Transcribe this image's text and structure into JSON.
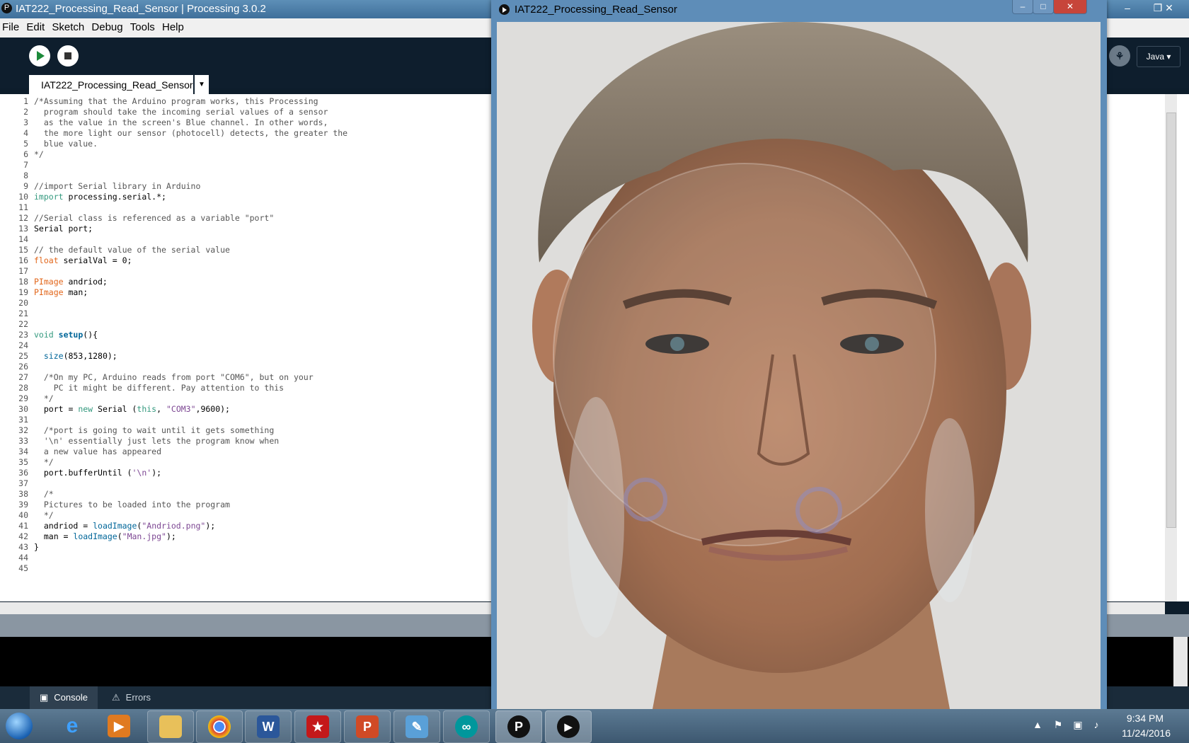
{
  "ide": {
    "title": "IAT222_Processing_Read_Sensor | Processing 3.0.2",
    "menu": [
      "File",
      "Edit",
      "Sketch",
      "Debug",
      "Tools",
      "Help"
    ],
    "mode": "Java ▾",
    "tab_name": "IAT222_Processing_Read_Sensor",
    "console_tab": "Console",
    "errors_tab": "Errors"
  },
  "code_lines": [
    "/*Assuming that the Arduino program works, this Processing",
    "  program should take the incoming serial values of a sensor",
    "  as the value in the screen's Blue channel. In other words,",
    "  the more light our sensor (photocell) detects, the greater the",
    "  blue value.",
    "*/",
    "",
    "",
    "//import Serial library in Arduino",
    "import processing.serial.*;",
    "",
    "//Serial class is referenced as a variable \"port\"",
    "Serial port;",
    "",
    "// the default value of the serial value",
    "float serialVal = 0;",
    "",
    "PImage andriod;",
    "PImage man;",
    "",
    "",
    "",
    "void setup(){",
    "",
    "  size(853,1280);",
    "",
    "  /*On my PC, Arduino reads from port \"COM6\", but on your",
    "    PC it might be different. Pay attention to this",
    "  */",
    "  port = new Serial (this, \"COM3\",9600);",
    "",
    "  /*port is going to wait until it gets something",
    "  '\\n' essentially just lets the program know when",
    "  a new value has appeared",
    "  */",
    "  port.bufferUntil ('\\n');",
    "",
    "  /*",
    "  Pictures to be loaded into the program",
    "  */",
    "  andriod = loadImage(\"Andriod.png\");",
    "  man = loadImage(\"Man.jpg\");",
    "}",
    "",
    ""
  ],
  "sketch": {
    "title": "IAT222_Processing_Read_Sensor"
  },
  "taskbar": {
    "time": "9:34 PM",
    "date": "11/24/2016"
  }
}
